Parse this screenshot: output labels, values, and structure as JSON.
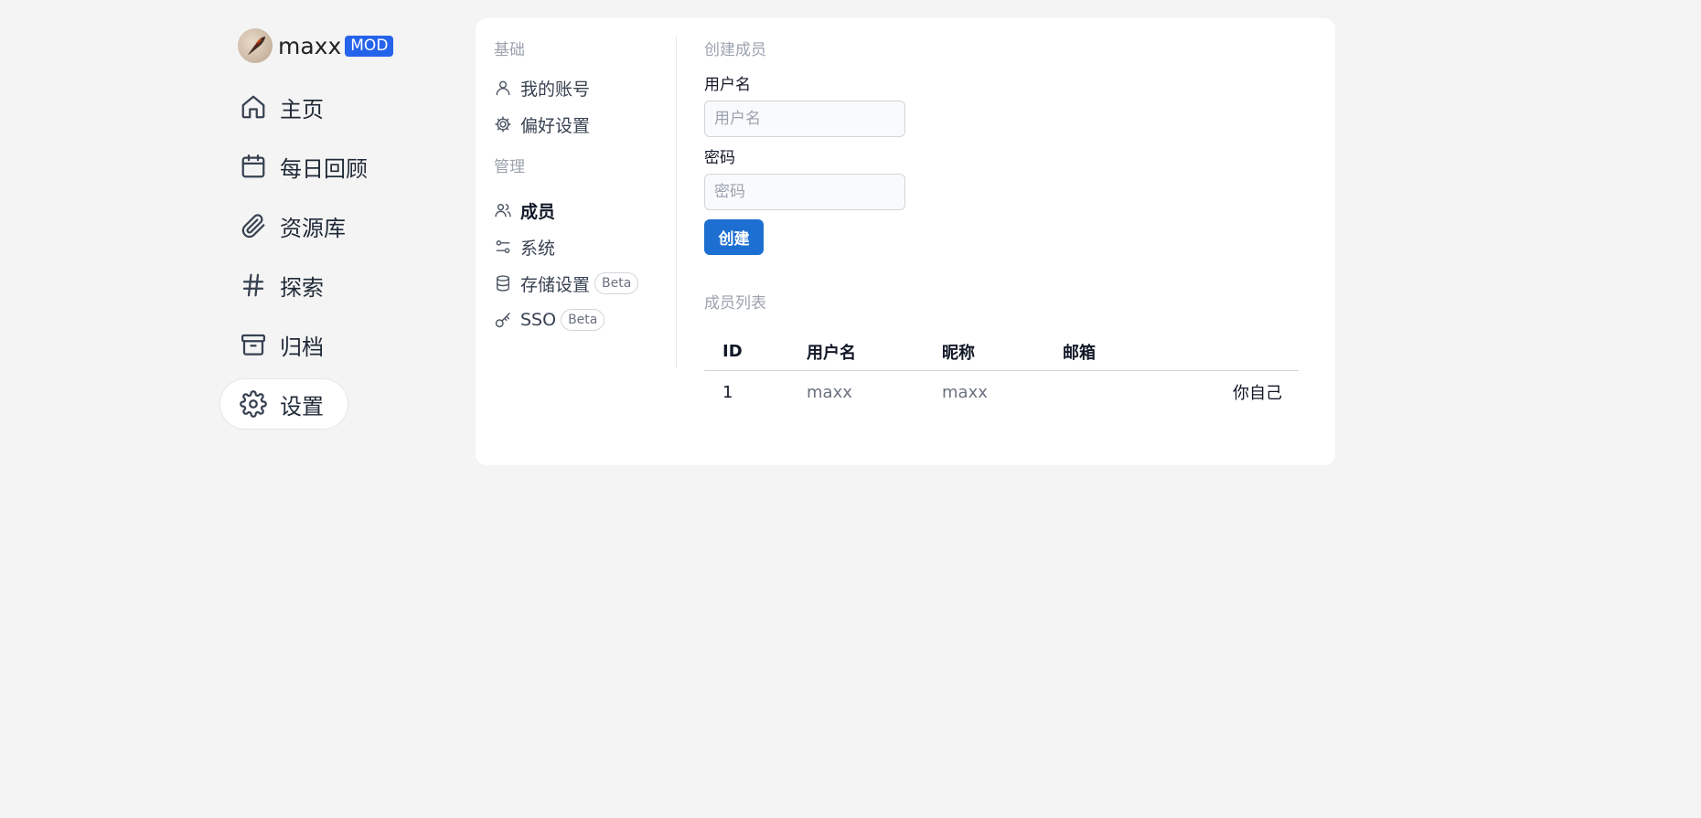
{
  "user": {
    "name": "maxx",
    "badge": "MOD"
  },
  "nav": [
    {
      "label": "主页",
      "icon": "home-icon"
    },
    {
      "label": "每日回顾",
      "icon": "calendar-icon"
    },
    {
      "label": "资源库",
      "icon": "paperclip-icon"
    },
    {
      "label": "探索",
      "icon": "hash-icon"
    },
    {
      "label": "归档",
      "icon": "archive-icon"
    },
    {
      "label": "设置",
      "icon": "gear-icon",
      "active": true
    }
  ],
  "settings_menu": {
    "basic_title": "基础",
    "basic_items": [
      {
        "label": "我的账号",
        "icon": "user-icon"
      },
      {
        "label": "偏好设置",
        "icon": "cog-icon"
      }
    ],
    "admin_title": "管理",
    "admin_items": [
      {
        "label": "成员",
        "icon": "users-icon",
        "active": true
      },
      {
        "label": "系统",
        "icon": "sliders-icon"
      },
      {
        "label": "存储设置",
        "icon": "database-icon",
        "badge": "Beta"
      },
      {
        "label": "SSO",
        "icon": "key-icon",
        "badge": "Beta"
      }
    ]
  },
  "create_member": {
    "title": "创建成员",
    "username_label": "用户名",
    "username_placeholder": "用户名",
    "password_label": "密码",
    "password_placeholder": "密码",
    "create_button": "创建"
  },
  "member_list": {
    "title": "成员列表",
    "columns": [
      "ID",
      "用户名",
      "昵称",
      "邮箱"
    ],
    "rows": [
      {
        "id": "1",
        "username": "maxx",
        "nickname": "maxx",
        "email": "",
        "note": "你自己"
      }
    ]
  }
}
